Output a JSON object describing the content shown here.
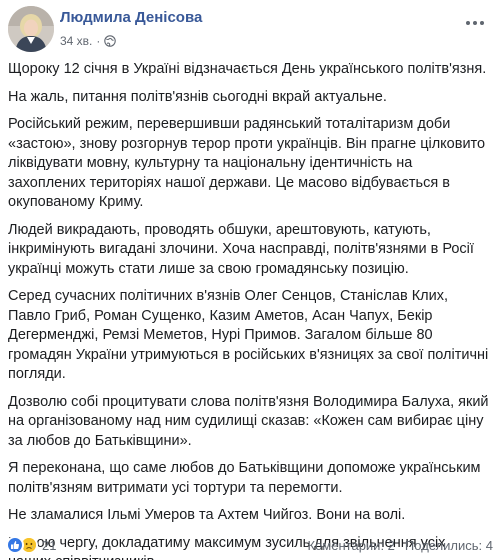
{
  "post": {
    "author": "Людмила Денісова",
    "time": "34 хв.",
    "dot": "·",
    "paragraphs": [
      "Щороку 12 січня в Україні відзначається День українського політв'язня.",
      "На жаль, питання політв'язнів сьогодні вкрай актуальне.",
      "Російський режим, перевершивши радянський тоталітаризм доби «застою», знову розгорнув терор проти українців. Він прагне цілковито ліквідувати мовну, культурну та національну ідентичність на захоплених територіях нашої держави. Це масово відбувається в окупованому Криму.",
      "Людей викрадають, проводять обшуки, арештовують, катують, інкримінують вигадані злочини. Хоча насправді, політв'язнями в Росії українці можуть стати лише за свою громадянську позицію.",
      "Серед сучасних політичних в'язнів Олег Сенцов, Станіслав Клих, Павло Гриб, Роман Сущенко, Казим Аметов, Асан Чапух, Бекір Дегерменджі, Ремзі Меметов, Нурі Примов. Загалом більше 80 громадян України утримуються в російських в'язницях за свої політичні погляди.",
      "Дозволю собі процитувати слова політв'язня Володимира Балуха, який на організованому над ним судилищі сказав: «Кожен сам вибирає ціну за любов до Батьківщини».",
      "Я переконана, що саме любов до Батьківщини допоможе українським політв'язням витримати усі тортури та перемогти.",
      "Не зламалися Ільмі Умеров та Ахтем Чийгоз. Вони на волі.",
      "В свою чергу, докладатиму максимум зусиль для звільнення усіх наших співвітчизників."
    ]
  },
  "footer": {
    "reaction_count": "21",
    "comments": "Коментарии: 2",
    "shares": "Поделились: 4"
  },
  "icons": {
    "avatar": "avatar-photo",
    "privacy": "globe-icon",
    "options": "more-options-icon",
    "reactions": [
      "like-icon",
      "sad-icon"
    ]
  },
  "colors": {
    "author_link": "#385898",
    "meta_text": "#616770",
    "body_text": "#1c1e21",
    "like_blue": "#3578e5",
    "sad_yellow": "#f7c42c"
  }
}
